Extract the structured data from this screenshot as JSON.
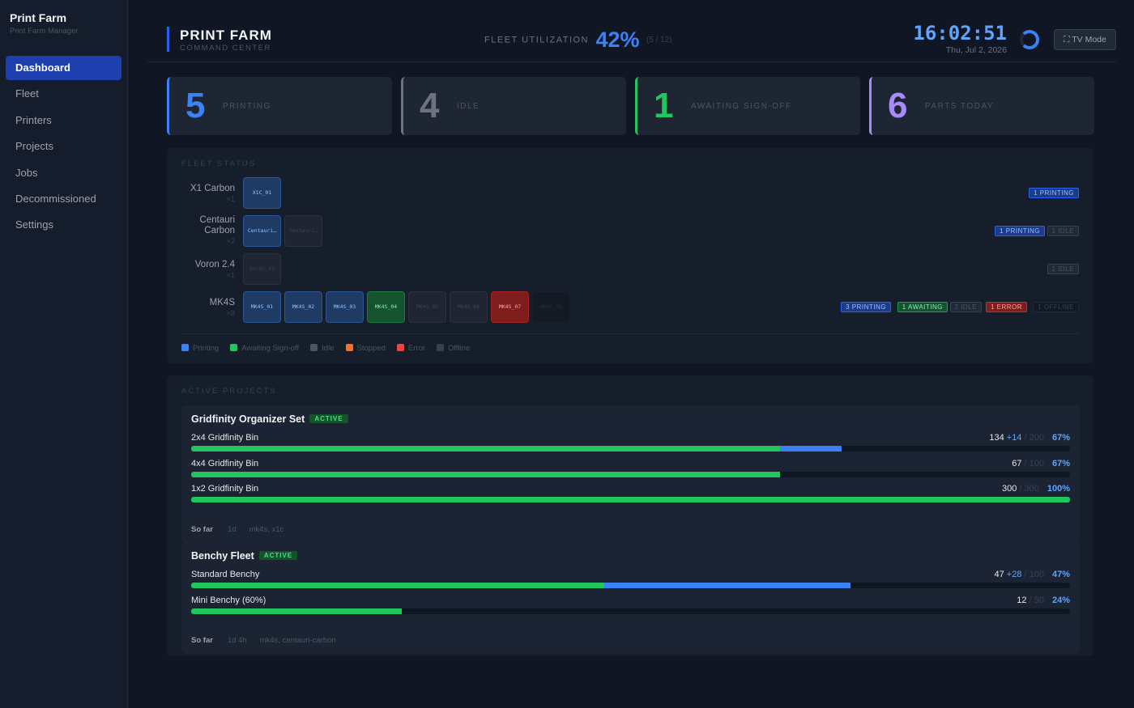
{
  "sidebar": {
    "title": "Print Farm",
    "subtitle": "Print Farm Manager",
    "items": [
      {
        "label": "Dashboard"
      },
      {
        "label": "Fleet"
      },
      {
        "label": "Printers"
      },
      {
        "label": "Projects"
      },
      {
        "label": "Jobs"
      },
      {
        "label": "Decommissioned"
      },
      {
        "label": "Settings"
      }
    ]
  },
  "header": {
    "title": "PRINT FARM",
    "subtitle": "COMMAND CENTER",
    "util_label": "FLEET UTILIZATION",
    "util_value": "42%",
    "util_frac": "(5 / 12)",
    "time": "16:02:51",
    "date": "Thu, Jul 2, 2026",
    "tv_mode": "⛶ TV Mode"
  },
  "stats": [
    {
      "value": "5",
      "label": "PRINTING",
      "color": "#3b82f6"
    },
    {
      "value": "4",
      "label": "IDLE",
      "color": "#6b7280"
    },
    {
      "value": "1",
      "label": "AWAITING SIGN-OFF",
      "color": "#22c55e"
    },
    {
      "value": "6",
      "label": "PARTS TODAY",
      "color": "#a78bfa"
    }
  ],
  "fleet": {
    "title": "FLEET STATUS",
    "rows": [
      {
        "name": "X1 Carbon",
        "count": "×1",
        "printers": [
          {
            "id": "X1C_01",
            "status": "printing"
          }
        ],
        "badges": [
          {
            "text": "1 PRINTING",
            "kind": "printing"
          }
        ]
      },
      {
        "name": "Centauri Carbon",
        "count": "×2",
        "printers": [
          {
            "id": "Centauri…",
            "status": "printing"
          },
          {
            "id": "Centauri…",
            "status": "idle"
          }
        ],
        "badges": [
          {
            "text": "1 PRINTING",
            "kind": "printing"
          },
          {
            "text": "1 IDLE",
            "kind": "idle"
          }
        ]
      },
      {
        "name": "Voron 2.4",
        "count": "×1",
        "printers": [
          {
            "id": "Voron_01",
            "status": "idle"
          }
        ],
        "badges": [
          {
            "text": "1 IDLE",
            "kind": "idle"
          }
        ]
      },
      {
        "name": "MK4S",
        "count": "×8",
        "printers": [
          {
            "id": "MK4S_01",
            "status": "printing"
          },
          {
            "id": "MK4S_02",
            "status": "printing"
          },
          {
            "id": "MK4S_03",
            "status": "printing"
          },
          {
            "id": "MK4S_04",
            "status": "awaiting"
          },
          {
            "id": "MK4S_05",
            "status": "idle"
          },
          {
            "id": "MK4S_06",
            "status": "idle"
          },
          {
            "id": "MK4S_07",
            "status": "error"
          },
          {
            "id": "MK4S_08",
            "status": "offline"
          }
        ],
        "badges": [
          {
            "text": "3 PRINTING",
            "kind": "printing"
          },
          {
            "text": "1 AWAITING",
            "kind": "awaiting"
          },
          {
            "text": "2 IDLE",
            "kind": "idle"
          },
          {
            "text": "1 ERROR",
            "kind": "error"
          },
          {
            "text": "1 OFFLINE",
            "kind": "offline"
          }
        ]
      }
    ],
    "legend": [
      {
        "label": "Printing",
        "color": "#3b82f6"
      },
      {
        "label": "Awaiting Sign-off",
        "color": "#22c55e"
      },
      {
        "label": "Idle",
        "color": "#4b5563"
      },
      {
        "label": "Stopped",
        "color": "#f97316"
      },
      {
        "label": "Error",
        "color": "#ef4444"
      },
      {
        "label": "Offline",
        "color": "#374151"
      }
    ]
  },
  "projects": {
    "title": "ACTIVE PROJECTS",
    "items": [
      {
        "name": "Gridfinity Organizer Set",
        "status": "ACTIVE",
        "parts": [
          {
            "name": "2x4 Gridfinity Bin",
            "done": "134",
            "plus": "+14",
            "total": "200",
            "pct": "67%",
            "done_frac": 0.67,
            "prog_frac": 0.07
          },
          {
            "name": "4x4 Gridfinity Bin",
            "done": "67",
            "plus": "",
            "total": "100",
            "pct": "67%",
            "done_frac": 0.67,
            "prog_frac": 0
          },
          {
            "name": "1x2 Gridfinity Bin",
            "done": "300",
            "plus": "",
            "total": "300",
            "pct": "100%",
            "done_frac": 1.0,
            "prog_frac": 0
          }
        ],
        "foot": {
          "label": "So far",
          "duration": "1d",
          "printers": "mk4s, x1c"
        }
      },
      {
        "name": "Benchy Fleet",
        "status": "ACTIVE",
        "parts": [
          {
            "name": "Standard Benchy",
            "done": "47",
            "plus": "+28",
            "total": "100",
            "pct": "47%",
            "done_frac": 0.47,
            "prog_frac": 0.28
          },
          {
            "name": "Mini Benchy (60%)",
            "done": "12",
            "plus": "",
            "total": "50",
            "pct": "24%",
            "done_frac": 0.24,
            "prog_frac": 0
          }
        ],
        "foot": {
          "label": "So far",
          "duration": "1d 4h",
          "printers": "mk4s, centauri-carbon"
        }
      }
    ]
  }
}
